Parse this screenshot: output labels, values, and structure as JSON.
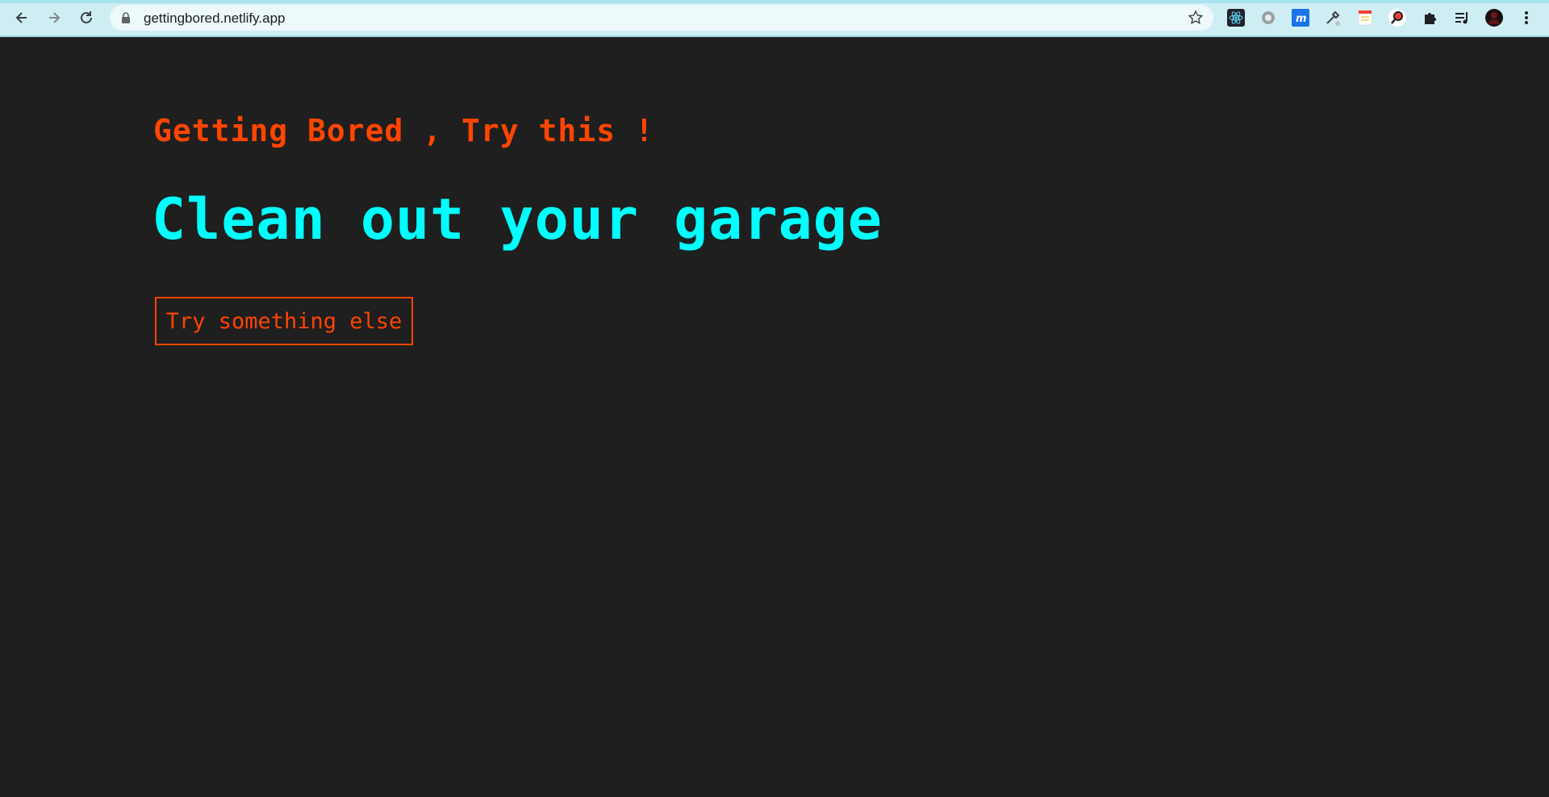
{
  "browser": {
    "url": "gettingbored.netlify.app",
    "nav": {
      "back_icon": "arrow-left-icon",
      "forward_icon": "arrow-right-icon",
      "reload_icon": "reload-icon"
    },
    "extensions": [
      "react-devtools-icon",
      "settings-gear-icon",
      "moqups-icon",
      "eyedropper-icon",
      "notes-icon",
      "search-magnifier-icon",
      "puzzle-extensions-icon",
      "reading-list-icon",
      "profile-avatar",
      "kebab-menu-icon"
    ],
    "colors": {
      "toolbar_bg": "#cfeef4",
      "omnibox_bg": "#eef9fb"
    }
  },
  "page": {
    "subtitle": "Getting Bored , Try this !",
    "activity": "Clean out your garage",
    "button_label": "Try something else",
    "colors": {
      "background": "#1e1f1e",
      "accent": "#ff4500",
      "activity": "#00ffff"
    }
  }
}
